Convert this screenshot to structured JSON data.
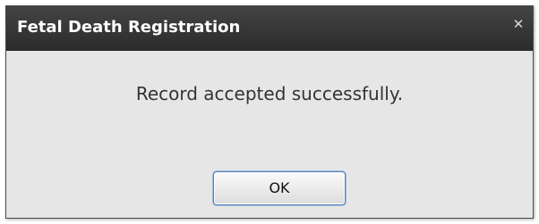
{
  "dialog": {
    "title": "Fetal Death Registration",
    "close_glyph": "✕",
    "message": "Record accepted successfully.",
    "ok_label": "OK"
  },
  "icons": {
    "close": "close-icon"
  },
  "colors": {
    "titlebar": "#333333",
    "body": "#e6e6e6",
    "button_border": "#5b7fb0"
  }
}
